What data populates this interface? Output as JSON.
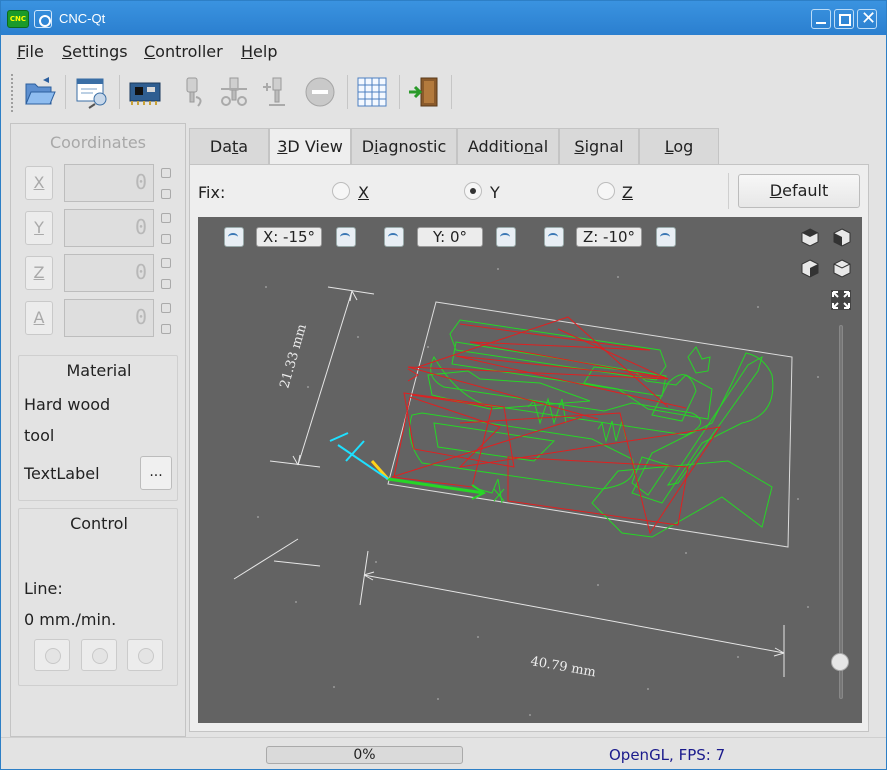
{
  "window": {
    "title": "CNC-Qt",
    "app_icon_text": "CNC"
  },
  "menu": {
    "items": [
      {
        "label": "File",
        "mnemonic": "F",
        "rest": "ile"
      },
      {
        "label": "Settings",
        "mnemonic": "S",
        "rest": "ettings"
      },
      {
        "label": "Controller",
        "mnemonic": "C",
        "rest": "ontroller"
      },
      {
        "label": "Help",
        "mnemonic": "H",
        "rest": "elp"
      }
    ]
  },
  "toolbar": {
    "buttons": [
      "open-file-icon",
      "settings-icon",
      "controller-board-icon",
      "spindle-down-icon",
      "tool-move-icon",
      "tool-probe-icon",
      "stop-icon",
      "grid-icon",
      "exit-door-icon"
    ]
  },
  "coordinates": {
    "title": "Coordinates",
    "axes": [
      {
        "label": "X",
        "value": "0"
      },
      {
        "label": "Y",
        "value": "0"
      },
      {
        "label": "Z",
        "value": "0"
      },
      {
        "label": "A",
        "value": "0"
      }
    ]
  },
  "material": {
    "title": "Material",
    "name": "Hard wood",
    "tool": "tool",
    "text_label": "TextLabel",
    "browse_label": "..."
  },
  "control": {
    "title": "Control",
    "line_label": "Line:",
    "speed": "0 mm./min."
  },
  "tabs": [
    {
      "label": "Data",
      "mnemonic": "t",
      "before": "Da",
      "after": "a"
    },
    {
      "label": "3D View",
      "mnemonic": "3",
      "before": "",
      "after": "D View"
    },
    {
      "label": "Diagnostic",
      "mnemonic": "i",
      "before": "D",
      "after": "agnostic"
    },
    {
      "label": "Additional",
      "mnemonic": "n",
      "before": "Additio",
      "after": "al"
    },
    {
      "label": "Signal",
      "mnemonic": "S",
      "before": "",
      "after": "ignal"
    },
    {
      "label": "Log",
      "mnemonic": "L",
      "before": "",
      "after": "og"
    }
  ],
  "view3d": {
    "fix_label": "Fix:",
    "fix_options": [
      {
        "label": "X",
        "underline": true,
        "checked": false
      },
      {
        "label": "Y",
        "underline": false,
        "checked": true
      },
      {
        "label": "Z",
        "underline": true,
        "checked": false
      }
    ],
    "default_button": {
      "before": "",
      "mnemonic": "D",
      "after": "efault"
    },
    "rotation": {
      "x": "X: -15°",
      "y": "Y: 0°",
      "z": "Z: -10°"
    },
    "dimension_y": "21.33 mm",
    "dimension_x": "40.79 mm",
    "colors": {
      "background": "#636363",
      "rapid": "#e02020",
      "cut": "#26d626",
      "axis_x": "#26d626",
      "axis_y": "#ffd21a",
      "axis_z": "#1ee0ff"
    }
  },
  "status": {
    "progress_text": "0%",
    "progress_value": 0,
    "fps_text": "OpenGL, FPS: 7"
  }
}
